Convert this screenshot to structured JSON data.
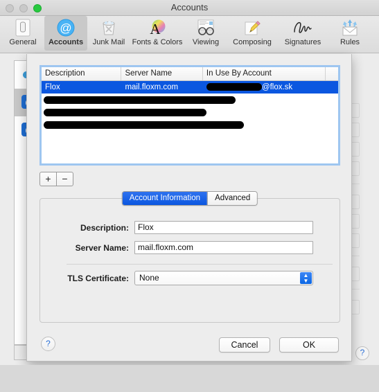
{
  "window": {
    "title": "Accounts",
    "traffic_lights": [
      {
        "name": "close",
        "color": "#c9c9c9"
      },
      {
        "name": "minimize",
        "color": "#c9c9c9"
      },
      {
        "name": "zoom",
        "color": "#27c93f"
      }
    ]
  },
  "toolbar": {
    "items": [
      {
        "label": "General",
        "icon": "general-icon",
        "selected": false
      },
      {
        "label": "Accounts",
        "icon": "at-sign-icon",
        "selected": true
      },
      {
        "label": "Junk Mail",
        "icon": "trash-icon",
        "selected": false
      },
      {
        "label": "Fonts & Colors",
        "icon": "font-colors-icon",
        "selected": false
      },
      {
        "label": "Viewing",
        "icon": "glasses-icon",
        "selected": false
      },
      {
        "label": "Composing",
        "icon": "pencil-icon",
        "selected": false
      },
      {
        "label": "Signatures",
        "icon": "signature-icon",
        "selected": false
      },
      {
        "label": "Rules",
        "icon": "rules-envelope-icon",
        "selected": false
      }
    ]
  },
  "accounts_sidebar": {
    "items": [
      {
        "icon": "icloud-cloud-icon",
        "selected": false
      },
      {
        "icon": "at-sign-icon",
        "selected": true
      },
      {
        "icon": "at-sign-icon",
        "selected": false
      }
    ],
    "add_label": "+"
  },
  "sheet": {
    "table": {
      "columns": [
        "Description",
        "Server Name",
        "In Use By Account",
        ""
      ],
      "rows": [
        {
          "selected": true,
          "description": "Flox",
          "server_name": "mail.floxm.com",
          "in_use_by_account": "@flox.sk",
          "account_redacted": true,
          "redacted_row": false
        },
        {
          "selected": false,
          "redacted_row": true,
          "redact_width": 277
        },
        {
          "selected": false,
          "redacted_row": true,
          "redact_width": 235
        },
        {
          "selected": false,
          "redacted_row": true,
          "redact_width": 289
        }
      ]
    },
    "add_remove": {
      "add_label": "+",
      "remove_label": "−"
    },
    "tabs": [
      {
        "label": "Account Information",
        "active": true
      },
      {
        "label": "Advanced",
        "active": false
      }
    ],
    "fields": [
      {
        "label": "Description:",
        "value": "Flox",
        "placeholder": ""
      },
      {
        "label": "Server Name:",
        "value": "mail.floxm.com",
        "placeholder": ""
      }
    ],
    "tls": {
      "label": "TLS Certificate:",
      "value": "None",
      "options": [
        "None"
      ]
    },
    "help_label": "?",
    "buttons": {
      "cancel": "Cancel",
      "ok": "OK"
    }
  },
  "behind": {
    "help_label": "?"
  },
  "colors": {
    "selection_blue": "#0b57e0",
    "focus_ring": "#9ec6f0",
    "window_bg": "#ececec",
    "zoom_green": "#27c93f",
    "link_blue": "#2a6fd6"
  }
}
